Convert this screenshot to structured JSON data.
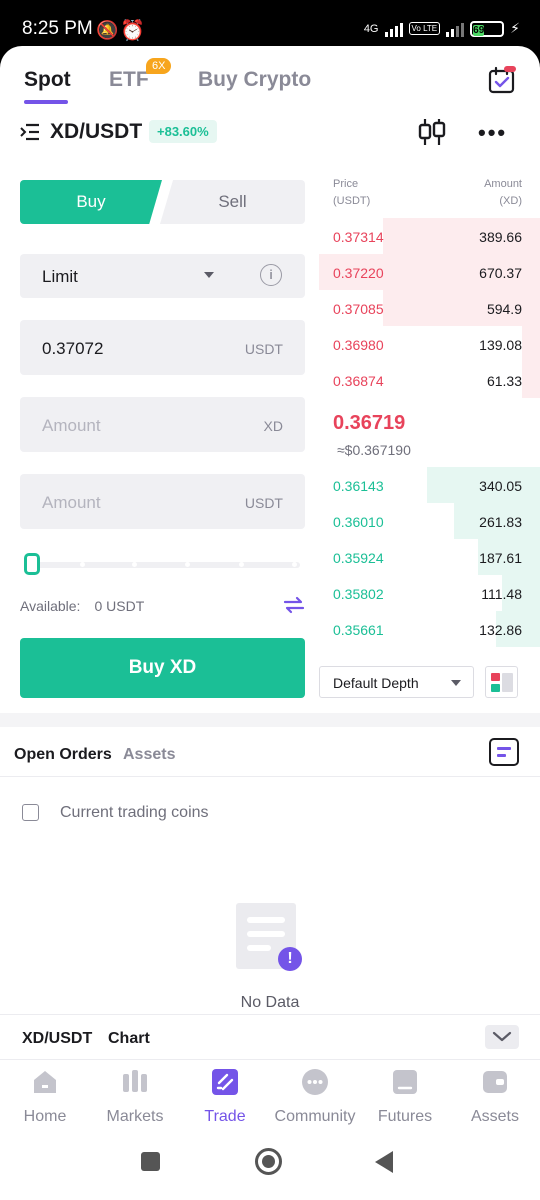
{
  "status": {
    "time": "8:25 PM",
    "network": "4G",
    "volte": "Vo LTE",
    "battery": "69"
  },
  "nav": {
    "tabs": [
      {
        "label": "Spot",
        "active": true
      },
      {
        "label": "ETF",
        "active": false,
        "badge": "6X"
      },
      {
        "label": "Buy Crypto",
        "active": false
      }
    ],
    "calendar_icon": "calendar-check-icon"
  },
  "pair": {
    "symbol": "XD/USDT",
    "change": "+83.60%"
  },
  "order_form": {
    "buy_label": "Buy",
    "sell_label": "Sell",
    "order_type": "Limit",
    "price_value": "0.37072",
    "price_unit": "USDT",
    "amount_placeholder": "Amount",
    "amount_unit": "XD",
    "total_placeholder": "Amount",
    "total_unit": "USDT",
    "slider_fraction": 0,
    "available_label": "Available:",
    "available_value": "0  USDT",
    "submit_label": "Buy XD"
  },
  "order_book": {
    "price_header": "Price",
    "price_unit": "(USDT)",
    "amount_header": "Amount",
    "amount_unit": "(XD)",
    "asks": [
      {
        "price": "0.37314",
        "amount": "389.66",
        "depth": 0.71
      },
      {
        "price": "0.37220",
        "amount": "670.37",
        "depth": 1.0
      },
      {
        "price": "0.37085",
        "amount": "594.9",
        "depth": 0.71
      },
      {
        "price": "0.36980",
        "amount": "139.08",
        "depth": 0.08
      },
      {
        "price": "0.36874",
        "amount": "61.33",
        "depth": 0.08
      }
    ],
    "last_price": "0.36719",
    "last_price_usd": "≈$0.367190",
    "bids": [
      {
        "price": "0.36143",
        "amount": "340.05",
        "depth": 0.51
      },
      {
        "price": "0.36010",
        "amount": "261.83",
        "depth": 0.39
      },
      {
        "price": "0.35924",
        "amount": "187.61",
        "depth": 0.28
      },
      {
        "price": "0.35802",
        "amount": "111.48",
        "depth": 0.17
      },
      {
        "price": "0.35661",
        "amount": "132.86",
        "depth": 0.2
      }
    ],
    "depth_select": "Default Depth"
  },
  "orders": {
    "tab_open": "Open Orders",
    "tab_assets": "Assets",
    "current_coins_label": "Current trading coins",
    "empty_text": "No Data"
  },
  "chart_bar": {
    "pair": "XD/USDT",
    "chart": "Chart"
  },
  "tabbar": [
    {
      "label": "Home",
      "icon": "home-icon",
      "active": false
    },
    {
      "label": "Markets",
      "icon": "markets-icon",
      "active": false
    },
    {
      "label": "Trade",
      "icon": "trade-icon",
      "active": true
    },
    {
      "label": "Community",
      "icon": "community-icon",
      "active": false
    },
    {
      "label": "Futures",
      "icon": "futures-icon",
      "active": false
    },
    {
      "label": "Assets",
      "icon": "wallet-icon",
      "active": false
    }
  ],
  "colors": {
    "buy": "#1bbf96",
    "sell": "#e8435b",
    "accent": "#7454e8"
  }
}
